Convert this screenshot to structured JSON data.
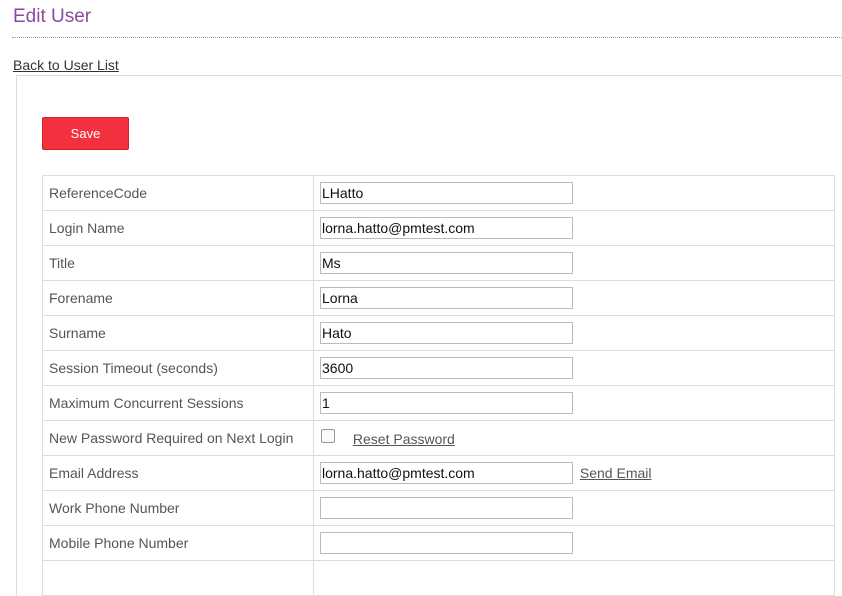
{
  "page": {
    "title": "Edit User",
    "back_link": "Back to User List",
    "save_label": "Save"
  },
  "fields": {
    "reference_code": {
      "label": "ReferenceCode",
      "value": "LHatto"
    },
    "login_name": {
      "label": "Login Name",
      "value": "lorna.hatto@pmtest.com"
    },
    "title": {
      "label": "Title",
      "value": "Ms"
    },
    "forename": {
      "label": "Forename",
      "value": "Lorna"
    },
    "surname": {
      "label": "Surname",
      "value": "Hato"
    },
    "session_timeout": {
      "label": "Session Timeout (seconds)",
      "value": "3600"
    },
    "max_sessions": {
      "label": "Maximum Concurrent Sessions",
      "value": "1"
    },
    "new_password": {
      "label": "New Password Required on Next Login",
      "checked": false,
      "link": "Reset Password"
    },
    "email": {
      "label": "Email Address",
      "value": "lorna.hatto@pmtest.com",
      "link": "Send Email"
    },
    "work_phone": {
      "label": "Work Phone Number",
      "value": ""
    },
    "mobile_phone": {
      "label": "Mobile Phone Number",
      "value": ""
    }
  },
  "colors": {
    "title": "#8a4a9e",
    "save_button": "#f2303e"
  }
}
